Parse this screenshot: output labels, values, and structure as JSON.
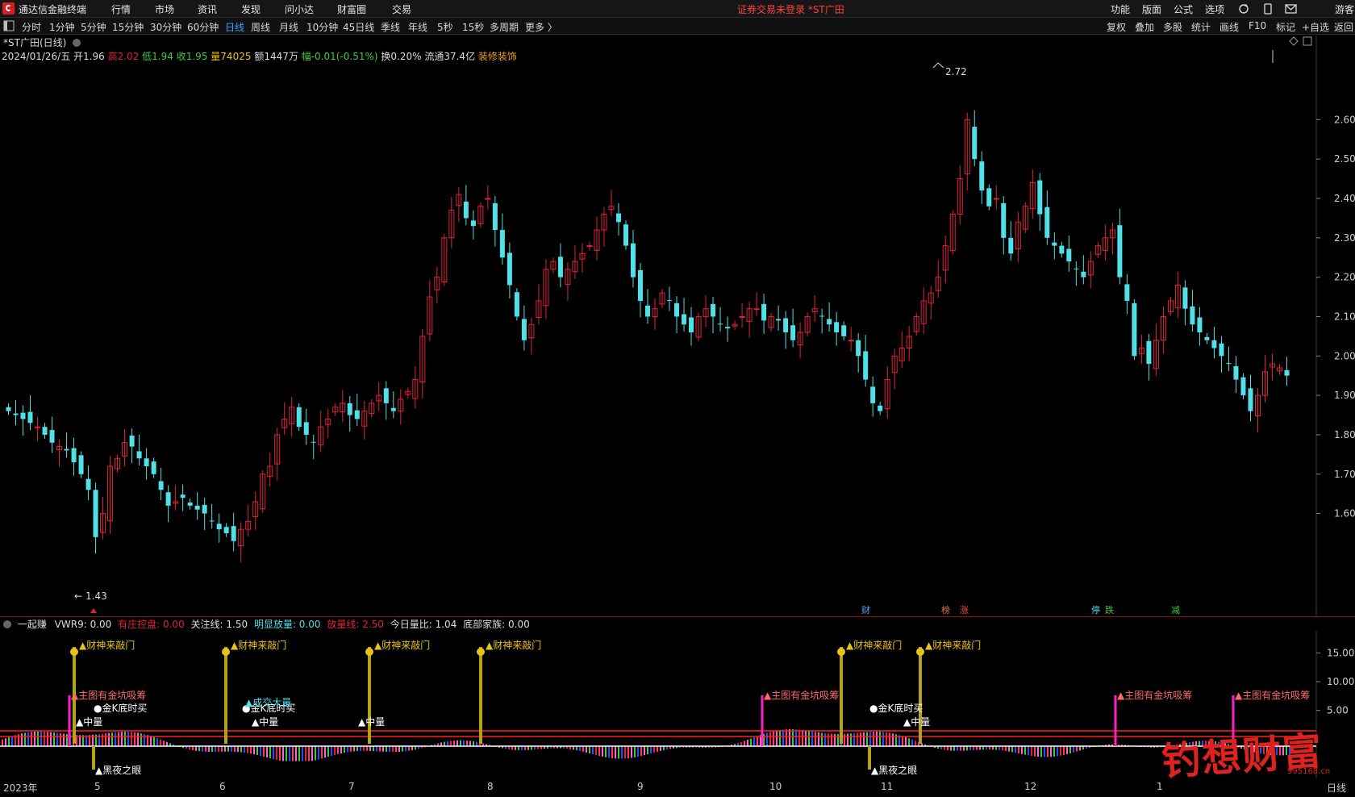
{
  "app": {
    "title": "通达信金融终端",
    "login_status": "证券交易未登录  *ST广田",
    "guest": "游客"
  },
  "menu": [
    "行情",
    "市场",
    "资讯",
    "发现",
    "问小达",
    "财富圈",
    "交易"
  ],
  "right_menu": [
    "功能",
    "版面",
    "公式",
    "选项"
  ],
  "toolbar": {
    "periods": [
      "分时",
      "1分钟",
      "5分钟",
      "15分钟",
      "30分钟",
      "60分钟",
      "日线",
      "周线",
      "月线",
      "10分钟",
      "45日线",
      "季线",
      "年线",
      "5秒",
      "15秒",
      "多周期",
      "更多 〉"
    ],
    "active": "日线",
    "right": [
      "复权",
      "叠加",
      "多股",
      "统计",
      "画线",
      "F10",
      "标记",
      "+自选",
      "返回"
    ]
  },
  "stock": {
    "title": "*ST广田(日线)",
    "date": "2024/01/26/五",
    "open": "开1.96",
    "high": "高2.02",
    "low": "低1.94",
    "close": "收1.95",
    "volume": "量74025",
    "amount": "额1447万",
    "change": "幅-0.01(-0.51%)",
    "turnover": "换0.20%",
    "float": "流通37.4亿",
    "sector": "装修装饰"
  },
  "colors": {
    "up": "#e0233b",
    "down": "#4fe0e8",
    "bg": "#000000",
    "accent": "#3aa0ff",
    "yellow": "#e8c11a"
  },
  "chart_data": [
    {
      "type": "candlestick",
      "title": "*ST广田(日线)",
      "y_ticks": [
        1.6,
        1.7,
        1.8,
        1.9,
        2.0,
        2.1,
        2.2,
        2.3,
        2.4,
        2.5,
        2.6
      ],
      "ylim": [
        1.38,
        2.74
      ],
      "annotations": {
        "high": "2.72",
        "low": "1.43"
      },
      "x_month_labels": [
        "2023年",
        "5",
        "6",
        "7",
        "8",
        "9",
        "10",
        "11",
        "12",
        "1"
      ],
      "period_label": "日线",
      "event_markers": [
        "财",
        "榜",
        "涨",
        "停",
        "跌",
        "减"
      ],
      "closes": [
        1.86,
        1.85,
        1.84,
        1.83,
        1.82,
        1.8,
        1.78,
        1.77,
        1.76,
        1.73,
        1.7,
        1.66,
        1.54,
        1.6,
        1.72,
        1.74,
        1.78,
        1.77,
        1.74,
        1.72,
        1.7,
        1.66,
        1.62,
        1.63,
        1.64,
        1.62,
        1.61,
        1.6,
        1.58,
        1.56,
        1.55,
        1.53,
        1.56,
        1.58,
        1.63,
        1.7,
        1.72,
        1.8,
        1.84,
        1.87,
        1.82,
        1.8,
        1.78,
        1.82,
        1.84,
        1.87,
        1.88,
        1.85,
        1.84,
        1.86,
        1.88,
        1.9,
        1.88,
        1.86,
        1.89,
        1.91,
        1.94,
        2.05,
        2.15,
        2.2,
        2.3,
        2.37,
        2.41,
        2.35,
        2.33,
        2.38,
        2.4,
        2.32,
        2.25,
        2.18,
        2.1,
        2.04,
        2.08,
        2.14,
        2.22,
        2.24,
        2.2,
        2.22,
        2.24,
        2.26,
        2.28,
        2.32,
        2.36,
        2.38,
        2.34,
        2.28,
        2.2,
        2.14,
        2.1,
        2.12,
        2.16,
        2.14,
        2.1,
        2.08,
        2.06,
        2.1,
        2.12,
        2.1,
        2.08,
        2.07,
        2.08,
        2.1,
        2.12,
        2.12,
        2.09,
        2.1,
        2.09,
        2.06,
        2.04,
        2.06,
        2.1,
        2.12,
        2.1,
        2.08,
        2.06,
        2.05,
        2.04,
        2.0,
        1.94,
        1.88,
        1.86,
        1.94,
        2.0,
        2.02,
        2.05,
        2.1,
        2.14,
        2.16,
        2.2,
        2.28,
        2.36,
        2.45,
        2.6,
        2.5,
        2.42,
        2.38,
        2.4,
        2.3,
        2.26,
        2.34,
        2.38,
        2.44,
        2.36,
        2.3,
        2.28,
        2.26,
        2.24,
        2.22,
        2.2,
        2.24,
        2.28,
        2.3,
        2.32,
        2.2,
        2.14,
        2.0,
        2.02,
        1.98,
        2.04,
        2.1,
        2.14,
        2.18,
        2.12,
        2.08,
        2.06,
        2.04,
        2.02,
        2.0,
        1.98,
        1.94,
        1.9,
        1.86,
        1.9,
        1.96,
        1.98,
        1.97,
        1.95
      ]
    },
    {
      "type": "bar",
      "title": "一起赚",
      "y_ticks": [
        5.0,
        10.0,
        15.0
      ],
      "ylim": [
        -5,
        18
      ]
    }
  ],
  "indicator": {
    "name": "一起赚",
    "vwr9": "VWR9: 0.00",
    "youzhuang": "有庄控盘: 0.00",
    "guanzhu": "关注线: 1.50",
    "mingxian": "明显放量: 0.00",
    "fangliang": "放量线: 2.50",
    "jinri": "今日量比: 1.04",
    "dibu": "底部家族: 0.00",
    "labels": {
      "caishen": "财神来敲门",
      "zhutu": "主图有金坑吸筹",
      "jink": "金K底时买",
      "zhongliang": "中量",
      "heiye": "黑夜之眼",
      "chengjiao": "成交大量"
    }
  },
  "watermark": {
    "text": "钓想财富",
    "url": "995168.cn"
  }
}
